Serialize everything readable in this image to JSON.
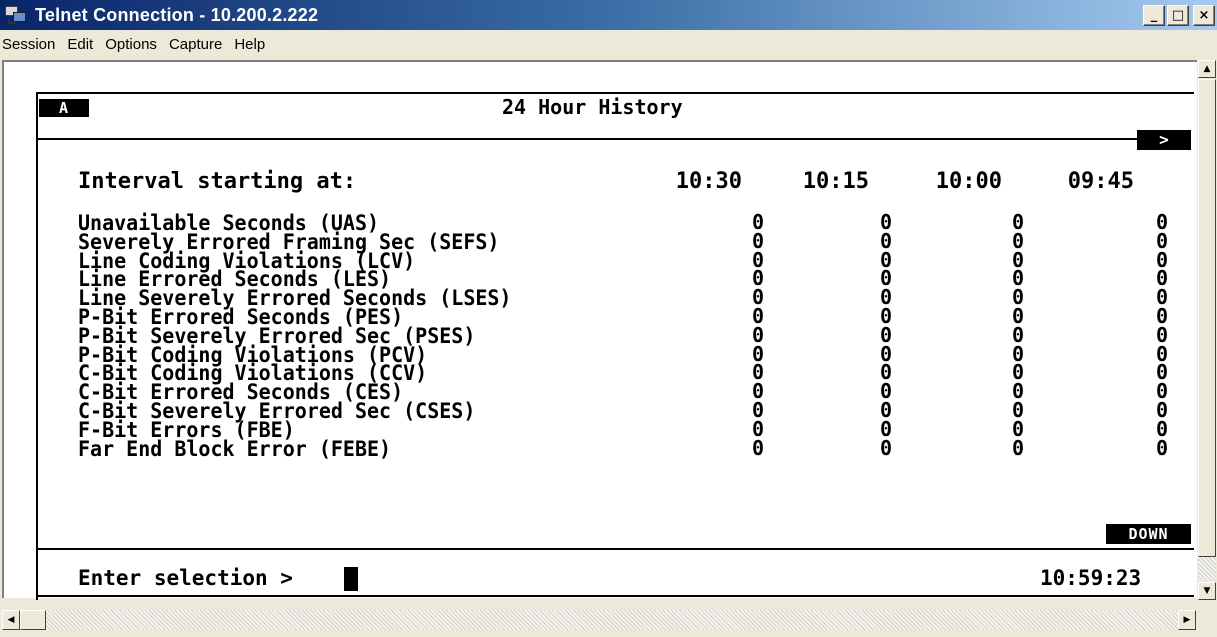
{
  "window": {
    "title": "Telnet Connection - 10.200.2.222",
    "controls": {
      "minimize": "_",
      "maximize": "□",
      "close": "×"
    }
  },
  "menu": [
    "Session",
    "Edit",
    "Options",
    "Capture",
    "Help"
  ],
  "terminal": {
    "page_tag": "A",
    "title": "24 Hour History",
    "more_indicator": ">",
    "interval_label": "Interval starting at:",
    "columns": [
      "10:30",
      "10:15",
      "10:00",
      "09:45"
    ],
    "rows": [
      {
        "label": "Unavailable Seconds (UAS)",
        "values": [
          "0",
          "0",
          "0",
          "0"
        ]
      },
      {
        "label": "Severely Errored Framing Sec (SEFS)",
        "values": [
          "0",
          "0",
          "0",
          "0"
        ]
      },
      {
        "label": "Line Coding Violations (LCV)",
        "values": [
          "0",
          "0",
          "0",
          "0"
        ]
      },
      {
        "label": "Line Errored Seconds (LES)",
        "values": [
          "0",
          "0",
          "0",
          "0"
        ]
      },
      {
        "label": "Line Severely Errored Seconds (LSES)",
        "values": [
          "0",
          "0",
          "0",
          "0"
        ]
      },
      {
        "label": "P-Bit Errored Seconds (PES)",
        "values": [
          "0",
          "0",
          "0",
          "0"
        ]
      },
      {
        "label": "P-Bit Severely Errored Sec (PSES)",
        "values": [
          "0",
          "0",
          "0",
          "0"
        ]
      },
      {
        "label": "P-Bit Coding Violations (PCV)",
        "values": [
          "0",
          "0",
          "0",
          "0"
        ]
      },
      {
        "label": "C-Bit Coding Violations (CCV)",
        "values": [
          "0",
          "0",
          "0",
          "0"
        ]
      },
      {
        "label": "C-Bit Errored Seconds (CES)",
        "values": [
          "0",
          "0",
          "0",
          "0"
        ]
      },
      {
        "label": "C-Bit Severely Errored Sec (CSES)",
        "values": [
          "0",
          "0",
          "0",
          "0"
        ]
      },
      {
        "label": "F-Bit Errors (FBE)",
        "values": [
          "0",
          "0",
          "0",
          "0"
        ]
      },
      {
        "label": "Far End Block Error (FEBE)",
        "values": [
          "0",
          "0",
          "0",
          "0"
        ]
      }
    ],
    "down_indicator": "DOWN",
    "prompt": "Enter selection >",
    "clock": "10:59:23"
  },
  "scrollbars": {
    "up": "▲",
    "down": "▼",
    "left": "◀",
    "right": "▶"
  }
}
